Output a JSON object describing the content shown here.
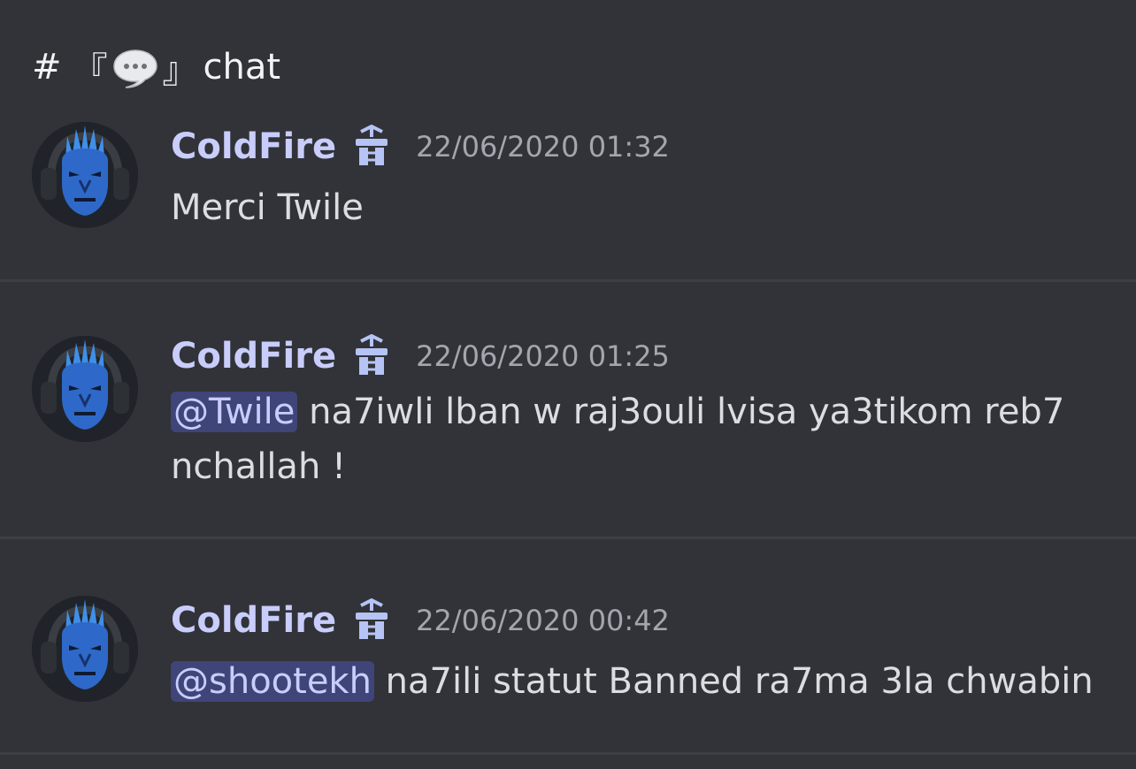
{
  "channel": {
    "hash": "#",
    "bracket_open": "『",
    "bracket_close": "』",
    "name": "chat",
    "icon": "speech-bubble-icon"
  },
  "messages": [
    {
      "username": "ColdFire",
      "badge_icon": "server-tag-badge-icon",
      "timestamp": "22/06/2020 01:32",
      "mention": "",
      "text": "Merci Twile"
    },
    {
      "username": "ColdFire",
      "badge_icon": "server-tag-badge-icon",
      "timestamp": "22/06/2020 01:25",
      "mention": "@Twile",
      "text": "na7iwli lban w raj3ouli lvisa ya3tikom reb7 nchallah !"
    },
    {
      "username": "ColdFire",
      "badge_icon": "server-tag-badge-icon",
      "timestamp": "22/06/2020 00:42",
      "mention": "@shootekh",
      "text": "na7ili statut Banned ra7ma 3la chwabin"
    }
  ],
  "colors": {
    "background": "#313338",
    "username": "#c9cdfb",
    "mention_bg": "#3f4578",
    "timestamp": "#a3a6ad",
    "divider": "#3c3f45"
  }
}
